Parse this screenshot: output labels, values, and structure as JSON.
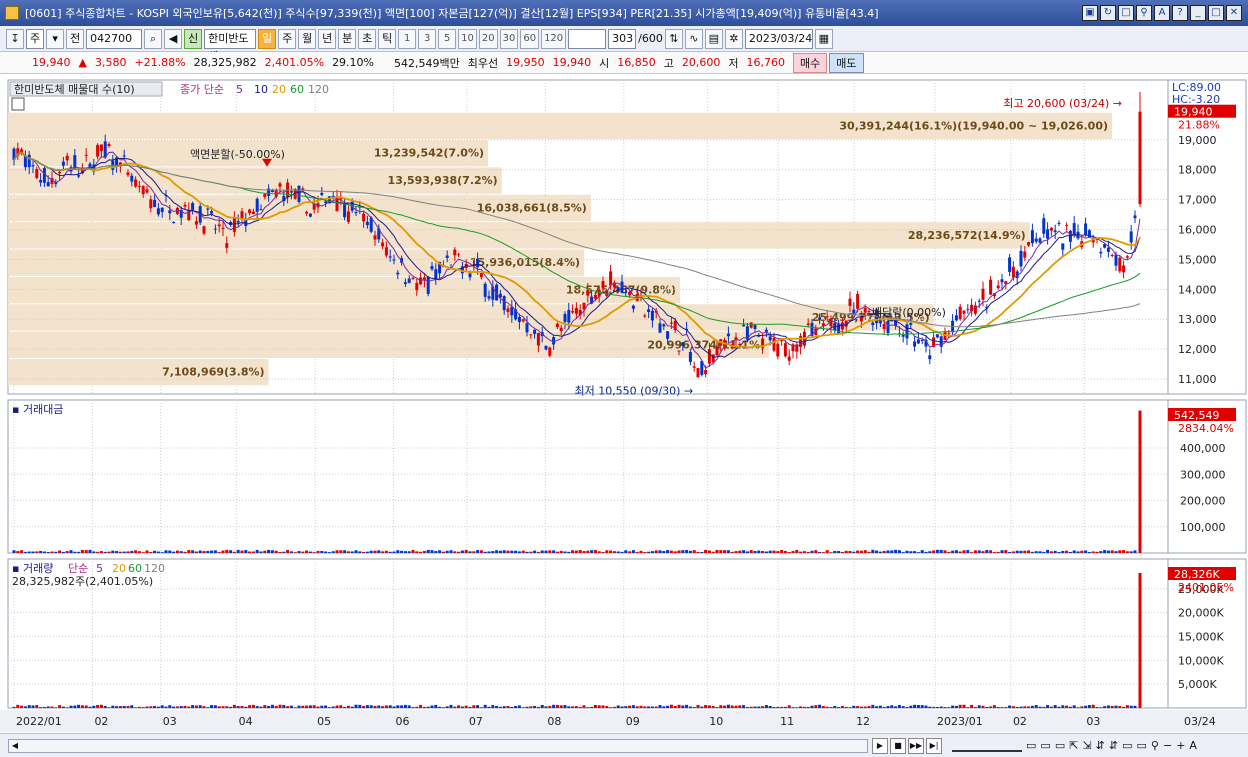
{
  "window": {
    "title": "[0601] 주식종합차트 - KOSPI 외국인보유[5,642(천)] 주식수[97,339(천)] 액면[100] 자본금[127(억)] 결산[12월] EPS[934] PER[21.35] 시가총액[19,409(억)] 유통비율[43.4]"
  },
  "toolbar": {
    "market_select": "주",
    "prev_label": "전",
    "stock_code": "042700",
    "stock_name": "한미반도체",
    "new_badge": "신",
    "periods": [
      "일",
      "주",
      "월",
      "년",
      "분",
      "초",
      "틱"
    ],
    "intervals": [
      "1",
      "3",
      "5",
      "10",
      "20",
      "30",
      "60",
      "120"
    ],
    "count": "303",
    "count_max": "/600",
    "date": "2023/03/24"
  },
  "quote": {
    "price": "19,940",
    "direction": "▲",
    "change": "3,580",
    "change_pct": "+21.88%",
    "volume": "28,325,982",
    "volume_ratio": "2,401.05%",
    "turnover": "29.10%",
    "amount": "542,549백만",
    "best_label": "최우선",
    "ask": "19,950",
    "bid": "19,940",
    "open_label": "시",
    "open": "16,850",
    "high_label": "고",
    "high": "20,600",
    "low_label": "저",
    "low": "16,760",
    "buy_label": "매수",
    "sell_label": "매도"
  },
  "colors": {
    "up": "#e00000",
    "down": "#0033cc",
    "ma5": "#7a2aa0",
    "ma10": "#1a1a8a",
    "ma20": "#e09a00",
    "ma60": "#169c2a",
    "ma120": "#808080",
    "vbp": "#f3e2cc",
    "grid": "#c8ccd6"
  },
  "chart_data": {
    "type": "candlestick",
    "price_pane": {
      "title": "한미반도체 매물대 수(10)",
      "ma_label": "종가 단순",
      "ma_periods": [
        "5",
        "10",
        "20",
        "60",
        "120"
      ],
      "lc_label": "LC:89.00",
      "hc_label": "HC:-3.20",
      "current_price_tag": "19,940",
      "current_pct_tag": "21.88%",
      "y_ticks": [
        "19,000",
        "18,000",
        "17,000",
        "16,000",
        "15,000",
        "14,000",
        "13,000",
        "12,000",
        "11,000"
      ],
      "ylim": [
        10500,
        21000
      ],
      "high_annotation": "최고 20,600 (03/24)",
      "low_annotation": "최저 10,550 (09/30)",
      "split_annotation": "액면분할(-50.00%)",
      "dividend_annotation": "배당락(0.00%)",
      "volume_profile": [
        {
          "label": "30,391,244(16.1%)(19,940.00 ~ 19,026.00)",
          "low": 19026,
          "high": 19940,
          "pct": 16.1
        },
        {
          "label": "13,239,542(7.0%)",
          "low": 18111,
          "high": 19026,
          "pct": 7.0
        },
        {
          "label": "13,593,938(7.2%)",
          "low": 17195,
          "high": 18111,
          "pct": 7.2
        },
        {
          "label": "16,038,661(8.5%)",
          "low": 16280,
          "high": 17195,
          "pct": 8.5
        },
        {
          "label": "28,236,572(14.9%)",
          "low": 15365,
          "high": 16280,
          "pct": 14.9
        },
        {
          "label": "15,936,015(8.4%)",
          "low": 14450,
          "high": 15365,
          "pct": 8.4
        },
        {
          "label": "18,575,467(9.8%)",
          "low": 13535,
          "high": 14450,
          "pct": 9.8
        },
        {
          "label": "25,499,776(13.5%)",
          "low": 12620,
          "high": 13535,
          "pct": 13.5
        },
        {
          "label": "20,996,374(11.1%)",
          "low": 11705,
          "high": 12620,
          "pct": 11.1
        },
        {
          "label": "7,108,969(3.8%)",
          "low": 10790,
          "high": 11705,
          "pct": 3.8
        }
      ],
      "close_path": [
        [
          "2022/01/03",
          18700
        ],
        [
          "2022/01/10",
          18000
        ],
        [
          "2022/01/17",
          17600
        ],
        [
          "2022/01/24",
          18200
        ],
        [
          "2022/01/31",
          18000
        ],
        [
          "2022/02/07",
          18700
        ],
        [
          "2022/02/14",
          18200
        ],
        [
          "2022/02/21",
          17300
        ],
        [
          "2022/02/28",
          16800
        ],
        [
          "2022/03/07",
          16700
        ],
        [
          "2022/03/14",
          16700
        ],
        [
          "2022/03/21",
          16300
        ],
        [
          "2022/03/28",
          15700
        ],
        [
          "2022/04/04",
          16400
        ],
        [
          "2022/04/11",
          16800
        ],
        [
          "2022/04/18",
          17300
        ],
        [
          "2022/04/25",
          17000
        ],
        [
          "2022/05/02",
          16600
        ],
        [
          "2022/05/09",
          17300
        ],
        [
          "2022/05/16",
          16600
        ],
        [
          "2022/05/23",
          16200
        ],
        [
          "2022/05/30",
          15300
        ],
        [
          "2022/06/06",
          14700
        ],
        [
          "2022/06/13",
          14000
        ],
        [
          "2022/06/20",
          14600
        ],
        [
          "2022/06/27",
          14900
        ],
        [
          "2022/07/04",
          14700
        ],
        [
          "2022/07/11",
          13900
        ],
        [
          "2022/07/18",
          13300
        ],
        [
          "2022/07/25",
          12800
        ],
        [
          "2022/08/01",
          12100
        ],
        [
          "2022/08/08",
          12700
        ],
        [
          "2022/08/15",
          13400
        ],
        [
          "2022/08/22",
          14100
        ],
        [
          "2022/08/29",
          14300
        ],
        [
          "2022/09/05",
          13700
        ],
        [
          "2022/09/12",
          13100
        ],
        [
          "2022/09/19",
          12700
        ],
        [
          "2022/09/26",
          12200
        ],
        [
          "2022/09/30",
          11000
        ],
        [
          "2022/10/07",
          11900
        ],
        [
          "2022/10/14",
          12400
        ],
        [
          "2022/10/21",
          12500
        ],
        [
          "2022/10/28",
          12200
        ],
        [
          "2022/11/04",
          11900
        ],
        [
          "2022/11/11",
          12500
        ],
        [
          "2022/11/18",
          12600
        ],
        [
          "2022/11/25",
          13000
        ],
        [
          "2022/12/02",
          13400
        ],
        [
          "2022/12/09",
          13100
        ],
        [
          "2022/12/16",
          12900
        ],
        [
          "2022/12/23",
          12600
        ],
        [
          "2022/12/30",
          11800
        ],
        [
          "2023/01/06",
          12500
        ],
        [
          "2023/01/13",
          13100
        ],
        [
          "2023/01/20",
          13500
        ],
        [
          "2023/01/27",
          14200
        ],
        [
          "2023/02/03",
          14700
        ],
        [
          "2023/02/10",
          15800
        ],
        [
          "2023/02/17",
          15900
        ],
        [
          "2023/02/24",
          15700
        ],
        [
          "2023/03/03",
          16000
        ],
        [
          "2023/03/10",
          15600
        ],
        [
          "2023/03/17",
          14700
        ],
        [
          "2023/03/21",
          15700
        ],
        [
          "2023/03/23",
          16360
        ],
        [
          "2023/03/24",
          19940
        ]
      ]
    },
    "amount_pane": {
      "title": "거래대금",
      "last_value_tag": "542,549",
      "last_pct_tag": "2834.04%",
      "y_ticks": [
        "400,000",
        "300,000",
        "200,000",
        "100,000"
      ],
      "ylim": [
        0,
        560000
      ],
      "last_value": 542549
    },
    "volume_pane": {
      "title": "거래량",
      "ma_label": "단순",
      "ma_periods": [
        "5",
        "20",
        "60",
        "120"
      ],
      "summary": "28,325,982주(2,401.05%)",
      "last_value_tag": "28,326K",
      "last_pct_tag": "2401.05%",
      "y_ticks": [
        "25,000K",
        "20,000K",
        "15,000K",
        "10,000K",
        "5,000K"
      ],
      "ylim": [
        0,
        30000
      ],
      "last_value": 28326
    },
    "x_ticks": [
      "2022/01",
      "02",
      "03",
      "04",
      "05",
      "06",
      "07",
      "08",
      "09",
      "10",
      "11",
      "12",
      "2023/01",
      "02",
      "03"
    ],
    "x_current_label": "03/24"
  },
  "bottom": {
    "zoom_minus": "−",
    "zoom_plus": "+",
    "text_size": "A"
  }
}
